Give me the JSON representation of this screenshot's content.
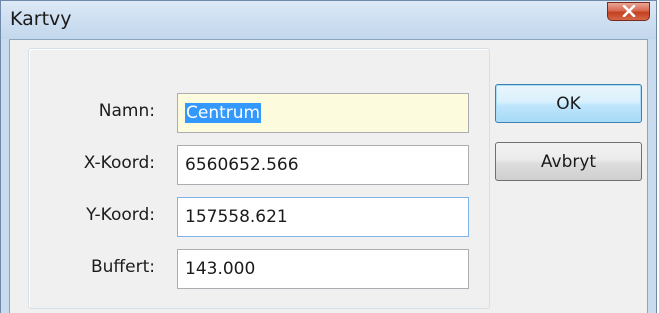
{
  "window": {
    "title": "Kartvy"
  },
  "fields": [
    {
      "label": "Namn:",
      "value": "Centrum"
    },
    {
      "label": "X-Koord:",
      "value": "6560652.566"
    },
    {
      "label": "Y-Koord:",
      "value": "157558.621"
    },
    {
      "label": "Buffert:",
      "value": "143.000"
    }
  ],
  "buttons": {
    "ok": "OK",
    "cancel": "Avbryt"
  },
  "icons": {
    "close": "close-icon"
  },
  "colors": {
    "close_button": "#d25a3e",
    "selection": "#3399ff",
    "focused_field_bg": "#fdfbdd"
  }
}
